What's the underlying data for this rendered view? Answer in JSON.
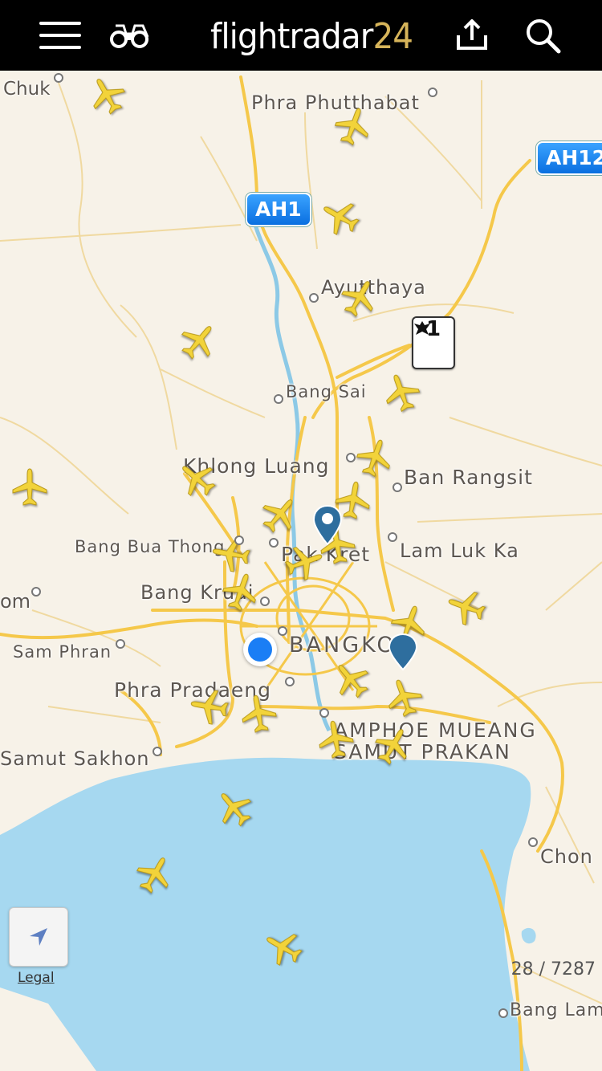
{
  "app": {
    "logo_main": "flightradar",
    "logo_num": "24"
  },
  "toolbar": {
    "menu_icon": "menu-icon",
    "binoculars_icon": "binoculars-icon",
    "share_icon": "share-icon",
    "search_icon": "search-icon"
  },
  "map": {
    "places": [
      {
        "name": "Chuk"
      },
      {
        "name": "Phra Phutthabat"
      },
      {
        "name": "Ayutthaya"
      },
      {
        "name": "Bang Sai"
      },
      {
        "name": "Khlong Luang"
      },
      {
        "name": "Ban Rangsit"
      },
      {
        "name": "Bang Bua Thong"
      },
      {
        "name": "Pak Kret"
      },
      {
        "name": "Lam Luk Ka"
      },
      {
        "name": "Bang Kruai"
      },
      {
        "name": "om"
      },
      {
        "name": "Sam Phran"
      },
      {
        "name": "BANGKOK"
      },
      {
        "name": "Phra Pradaeng"
      },
      {
        "name": "AMPHOE MUEANG"
      },
      {
        "name": "SAMUT PRAKAN"
      },
      {
        "name": "Samut Sakhon"
      },
      {
        "name": "Chon"
      },
      {
        "name": "Bang Lam"
      }
    ],
    "highway_shields": {
      "ah1": "AH1",
      "ah12": "AH12",
      "thai_route": "1"
    },
    "colors": {
      "land": "#f7f2e8",
      "water": "#a6d8f0",
      "roads": "#f5c84a",
      "planes": "#f2d33a",
      "location": "#1a7ef5",
      "pin": "#2e6e9e"
    }
  },
  "controls": {
    "locate_icon": "location-arrow-icon",
    "legal_label": "Legal",
    "aircraft_count": "28 / 7287"
  }
}
